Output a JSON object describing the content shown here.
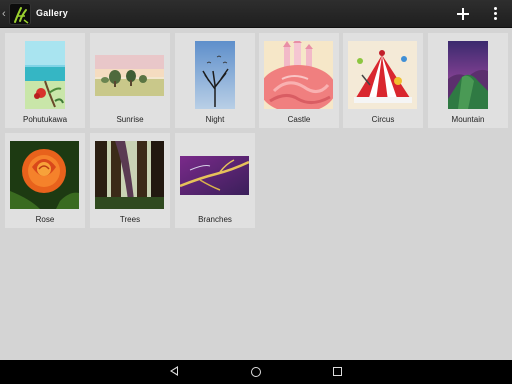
{
  "app": {
    "title": "Gallery",
    "icon": "paint-brush-app-icon",
    "up_icon": "chevron-left-icon"
  },
  "actions": {
    "add_icon": "plus-icon",
    "overflow_icon": "more-vert-icon"
  },
  "gallery": {
    "items": [
      {
        "label": "Pohutukawa"
      },
      {
        "label": "Sunrise"
      },
      {
        "label": "Night"
      },
      {
        "label": "Castle"
      },
      {
        "label": "Circus"
      },
      {
        "label": "Mountain"
      },
      {
        "label": "Rose"
      },
      {
        "label": "Trees"
      },
      {
        "label": "Branches"
      }
    ]
  },
  "navigation": {
    "back_icon": "back-triangle-icon",
    "home_icon": "home-circle-icon",
    "recents_icon": "recents-square-icon"
  },
  "colors": {
    "actionbar": "#262626",
    "background": "#d4d4d4",
    "tile": "#e0e0e0",
    "navbar": "#000000"
  }
}
